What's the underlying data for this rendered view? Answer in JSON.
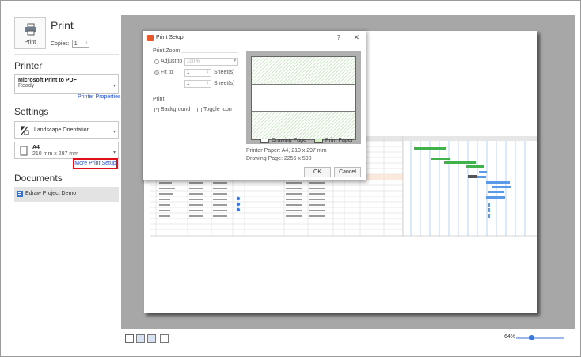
{
  "left": {
    "print_button_label": "Print",
    "print_heading": "Print",
    "copies_label": "Copies:",
    "copies_value": "1",
    "printer_heading": "Printer",
    "printer": {
      "name": "Microsoft Print to PDF",
      "status": "Ready"
    },
    "printer_properties": "Printer Properties",
    "settings_heading": "Settings",
    "orientation": "Landscape Orientation",
    "paper": {
      "name": "A4",
      "size": "210 mm x 297 mm"
    },
    "more_print_setup": "More Print Setup",
    "documents_heading": "Documents",
    "document_item": "Edraw Project Demo"
  },
  "dialog": {
    "title": "Print Setup",
    "help": "?",
    "close": "✕",
    "zoom_group": "Print Zoom",
    "adjust_to_label": "Adjust to",
    "adjust_to_value": "100 %",
    "fit_to_label": "Fit to",
    "fit_w_value": "1",
    "fit_h_value": "1",
    "sheets_label": "Sheet(s)",
    "print_group": "Print",
    "background_label": "Background",
    "toggle_icon_label": "Toggle Icon",
    "legend_drawing": "Drawing Page",
    "legend_print": "Print Paper",
    "printer_paper": "Printer Paper: A4, 210 x 297 mm",
    "drawing_page": "Drawing Page: 2256 x 590",
    "ok": "OK",
    "cancel": "Cancel"
  },
  "statusbar": {
    "zoom": "64%",
    "zoom_fraction": 0.3
  },
  "colors": {
    "accent_red": "#e0101a",
    "link_blue": "#1f4fd8",
    "gantt_green": "#3fb24a",
    "gantt_blue": "#5b9ae8",
    "preview_bg": "#a7a7a7"
  },
  "icons": [
    "printer-icon",
    "landscape-icon",
    "paper-icon",
    "document-icon",
    "view-single-icon",
    "view-grid-icon",
    "view-fit-icon",
    "view-width-icon"
  ]
}
